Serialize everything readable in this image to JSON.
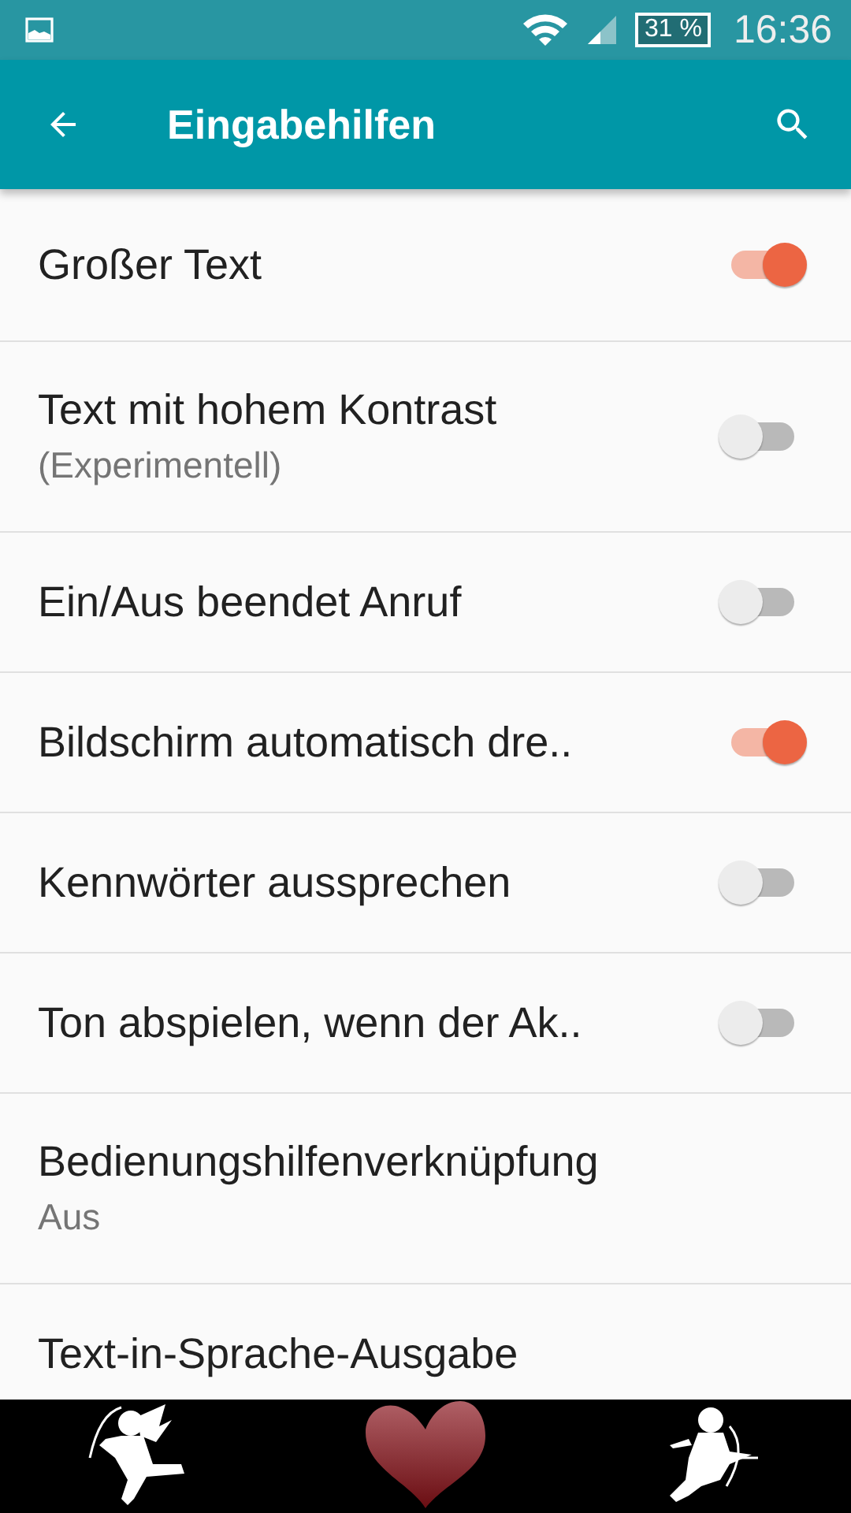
{
  "status_bar": {
    "battery": "31 %",
    "time": "16:36"
  },
  "toolbar": {
    "title": "Eingabehilfen"
  },
  "settings": [
    {
      "title": "Großer Text",
      "kind": "toggle",
      "on": true
    },
    {
      "title": "Text mit hohem Kontrast",
      "summary": "(Experimentell)",
      "kind": "toggle",
      "on": false
    },
    {
      "title": "Ein/Aus beendet Anruf",
      "kind": "toggle",
      "on": false
    },
    {
      "title": "Bildschirm automatisch dre..",
      "kind": "toggle",
      "on": true
    },
    {
      "title": "Kennwörter aussprechen",
      "kind": "toggle",
      "on": false
    },
    {
      "title": "Ton abspielen, wenn der Ak..",
      "kind": "toggle",
      "on": false
    },
    {
      "title": "Bedienungshilfenverknüpfung",
      "summary": "Aus",
      "kind": "link"
    },
    {
      "title": "Text-in-Sprache-Ausgabe",
      "kind": "link"
    }
  ]
}
